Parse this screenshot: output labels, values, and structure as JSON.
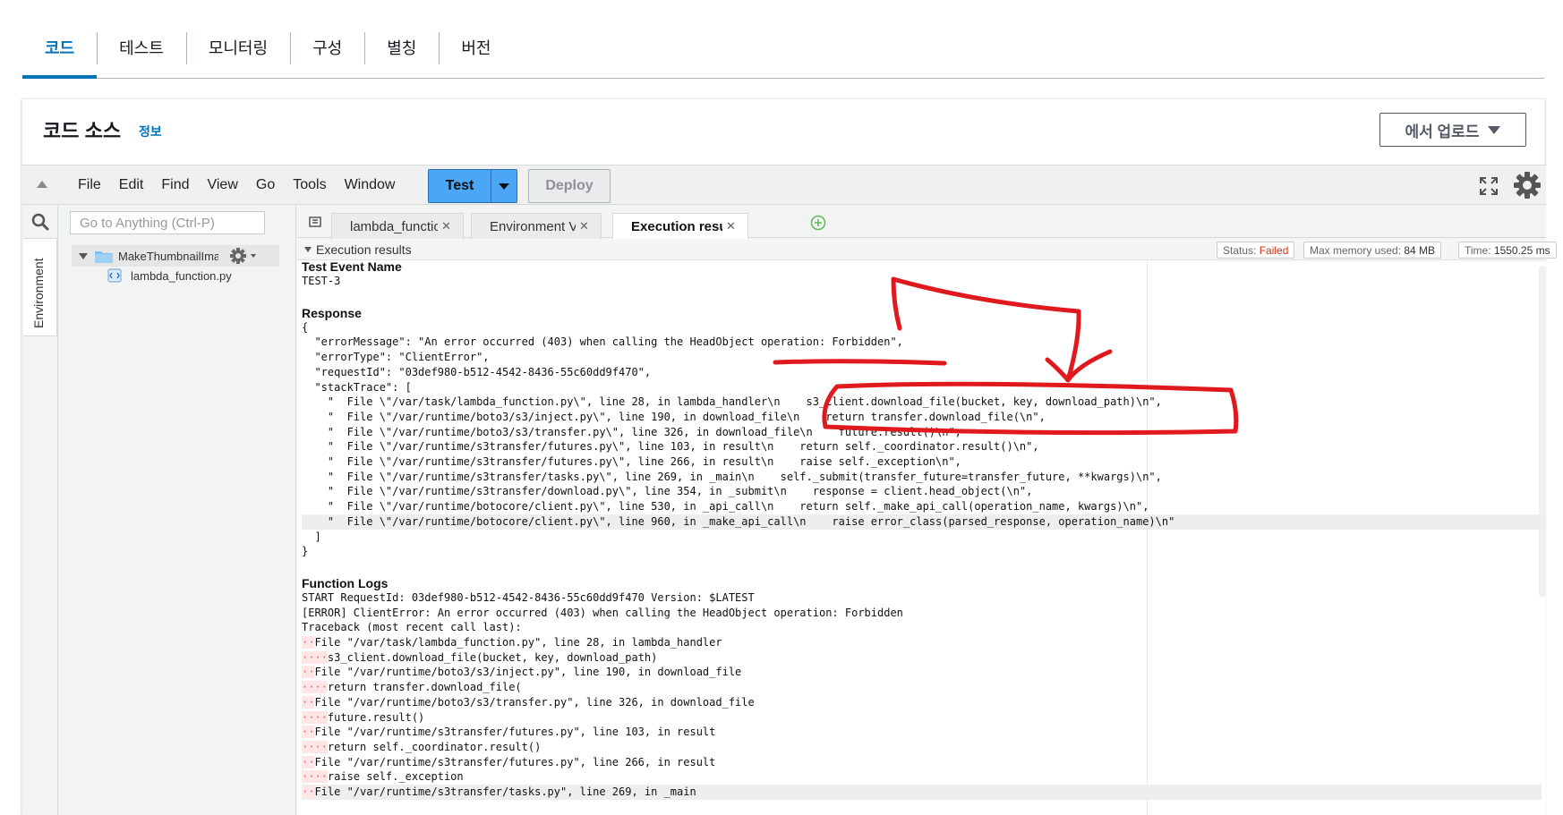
{
  "top_tabs": [
    "코드",
    "테스트",
    "모니터링",
    "구성",
    "별칭",
    "버전"
  ],
  "panel": {
    "title": "코드 소스",
    "info": "정보",
    "upload_label": "에서 업로드"
  },
  "menu": [
    "File",
    "Edit",
    "Find",
    "View",
    "Go",
    "Tools",
    "Window"
  ],
  "buttons": {
    "test": "Test",
    "deploy": "Deploy"
  },
  "sidebar": {
    "env_label": "Environment",
    "search_placeholder": "Go to Anything (Ctrl-P)",
    "root_folder": "MakeThumbnailImage",
    "file": "lambda_function.py"
  },
  "editor_tabs": [
    "lambda_function",
    "Environment Vari",
    "Execution results"
  ],
  "results": {
    "title": "Execution results",
    "status_label": "Status:",
    "status_value": "Failed",
    "memory_label": "Max memory used:",
    "memory_value": "84 MB",
    "time_label": "Time:",
    "time_value": "1550.25 ms",
    "test_event_heading": "Test Event Name",
    "test_event": "TEST-3",
    "response_heading": "Response",
    "response_lines": [
      "{",
      "  \"errorMessage\": \"An error occurred (403) when calling the HeadObject operation: Forbidden\",",
      "  \"errorType\": \"ClientError\",",
      "  \"requestId\": \"03def980-b512-4542-8436-55c60dd9f470\",",
      "  \"stackTrace\": [",
      "    \"  File \\\"/var/task/lambda_function.py\\\", line 28, in lambda_handler\\n    s3_client.download_file(bucket, key, download_path)\\n\",",
      "    \"  File \\\"/var/runtime/boto3/s3/inject.py\\\", line 190, in download_file\\n    return transfer.download_file(\\n\",",
      "    \"  File \\\"/var/runtime/boto3/s3/transfer.py\\\", line 326, in download_file\\n    future.result()\\n\",",
      "    \"  File \\\"/var/runtime/s3transfer/futures.py\\\", line 103, in result\\n    return self._coordinator.result()\\n\",",
      "    \"  File \\\"/var/runtime/s3transfer/futures.py\\\", line 266, in result\\n    raise self._exception\\n\",",
      "    \"  File \\\"/var/runtime/s3transfer/tasks.py\\\", line 269, in _main\\n    self._submit(transfer_future=transfer_future, **kwargs)\\n\",",
      "    \"  File \\\"/var/runtime/s3transfer/download.py\\\", line 354, in _submit\\n    response = client.head_object(\\n\",",
      "    \"  File \\\"/var/runtime/botocore/client.py\\\", line 530, in _api_call\\n    return self._make_api_call(operation_name, kwargs)\\n\",",
      "    \"  File \\\"/var/runtime/botocore/client.py\\\", line 960, in _make_api_call\\n    raise error_class(parsed_response, operation_name)\\n\"",
      "  ]",
      "}"
    ],
    "function_logs_heading": "Function Logs",
    "log_lines": [
      {
        "ws": "",
        "text": "START RequestId: 03def980-b512-4542-8436-55c60dd9f470 Version: $LATEST"
      },
      {
        "ws": "",
        "text": "[ERROR] ClientError: An error occurred (403) when calling the HeadObject operation: Forbidden"
      },
      {
        "ws": "",
        "text": "Traceback (most recent call last):"
      },
      {
        "ws": "··",
        "text": "File \"/var/task/lambda_function.py\", line 28, in lambda_handler"
      },
      {
        "ws": "····",
        "text": "s3_client.download_file(bucket, key, download_path)"
      },
      {
        "ws": "··",
        "text": "File \"/var/runtime/boto3/s3/inject.py\", line 190, in download_file"
      },
      {
        "ws": "····",
        "text": "return transfer.download_file("
      },
      {
        "ws": "··",
        "text": "File \"/var/runtime/boto3/s3/transfer.py\", line 326, in download_file"
      },
      {
        "ws": "····",
        "text": "future.result()"
      },
      {
        "ws": "··",
        "text": "File \"/var/runtime/s3transfer/futures.py\", line 103, in result"
      },
      {
        "ws": "····",
        "text": "return self._coordinator.result()"
      },
      {
        "ws": "··",
        "text": "File \"/var/runtime/s3transfer/futures.py\", line 266, in result"
      },
      {
        "ws": "····",
        "text": "raise self._exception"
      },
      {
        "ws": "··",
        "text": "File \"/var/runtime/s3transfer/tasks.py\", line 269, in _main"
      }
    ]
  },
  "colors": {
    "accent": "#0073bb",
    "test_button": "#4ba6f5",
    "failed": "#d13212",
    "annotation": "#e0191e"
  }
}
